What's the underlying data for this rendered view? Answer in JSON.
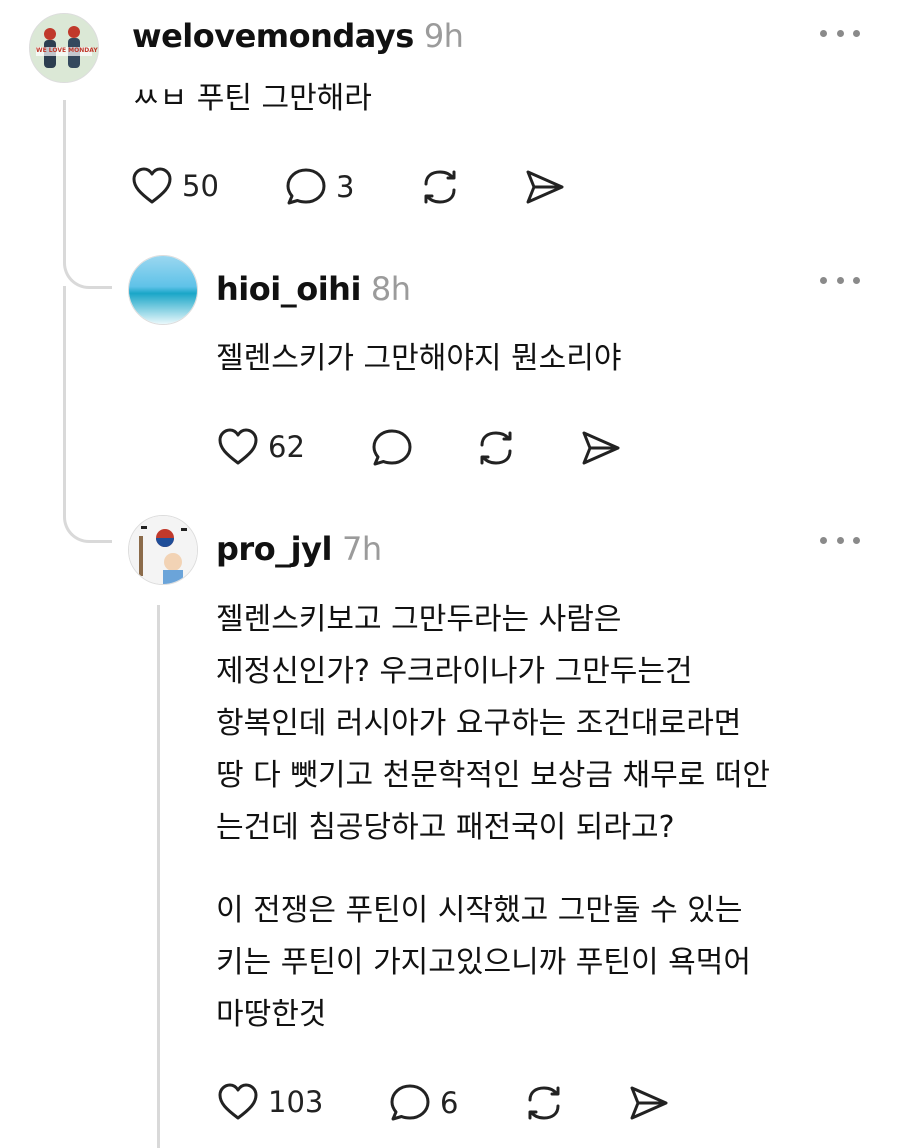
{
  "comments": [
    {
      "username": "welovemondays",
      "time": "9h",
      "text": "ㅆㅂ 푸틴 그만해라",
      "likes": "50",
      "replies": "3",
      "avatar_text": "WE LOVE MONDAY",
      "avatar_colors": [
        "#d9e9d8",
        "#c0392b",
        "#2c3e50"
      ]
    },
    {
      "username": "hioi_oihi",
      "time": "8h",
      "text": "젤렌스키가 그만해야지 뭔소리야",
      "likes": "62",
      "replies": "",
      "avatar_colors": [
        "#6fc3e6",
        "#2aa9c9",
        "#e8f7f9"
      ]
    },
    {
      "username": "pro_jyl",
      "time": "7h",
      "text": "젤렌스키보고 그만두라는 사람은\n제정신인가? 우크라이나가 그만두는건\n항복인데 러시아가 요구하는 조건대로라면\n땅 다 뺏기고 천문학적인 보상금 채무로 떠안\n는건데 침공당하고 패전국이 되라고?",
      "text2": "이 전쟁은 푸틴이 시작했고 그만둘 수 있는\n키는 푸틴이 가지고있으니까 푸틴이 욕먹어\n마땅한것",
      "likes": "103",
      "replies": "6",
      "avatar_colors": [
        "#f3f3f3",
        "#c0392b",
        "#1f4e99"
      ]
    }
  ],
  "icons": {
    "like": "heart-icon",
    "reply": "speech-bubble-icon",
    "repost": "repost-icon",
    "share": "send-icon",
    "more": "more-dots-icon"
  },
  "colors": {
    "text": "#111111",
    "muted": "#9b9b9b",
    "thread_line": "#d9d9d9"
  }
}
